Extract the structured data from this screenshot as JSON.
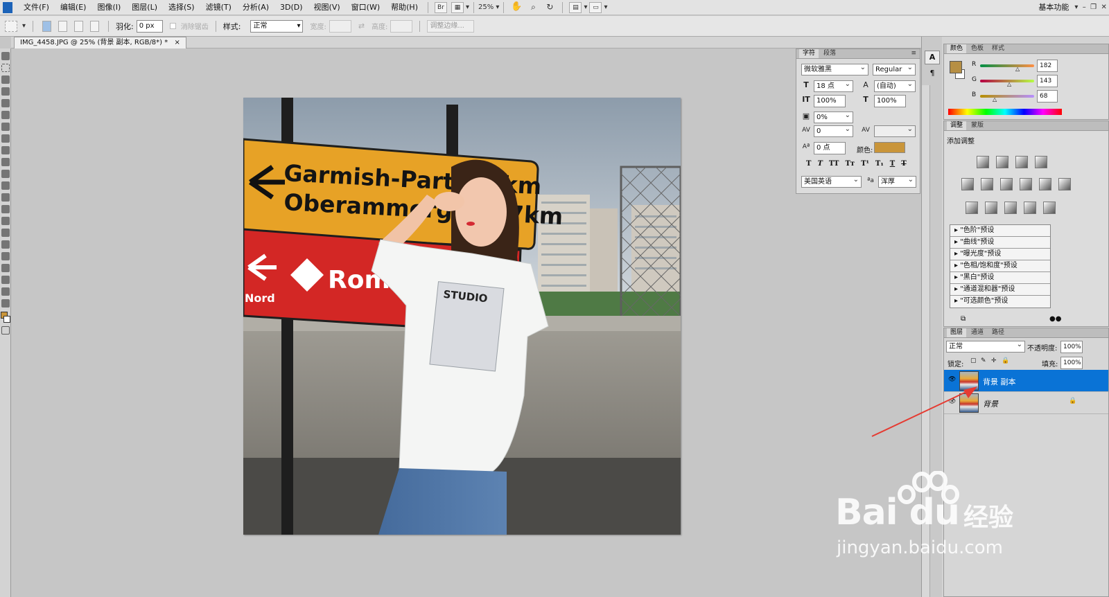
{
  "menubar": {
    "items": [
      "文件(F)",
      "编辑(E)",
      "图像(I)",
      "图层(L)",
      "选择(S)",
      "滤镜(T)",
      "分析(A)",
      "3D(D)",
      "视图(V)",
      "窗口(W)",
      "帮助(H)"
    ],
    "bridge_label": "Br",
    "zoom": "25%",
    "workspace": "基本功能"
  },
  "options": {
    "feather_label": "羽化:",
    "feather_value": "0 px",
    "antialias_label": "消除锯齿",
    "style_label": "样式:",
    "style_value": "正常",
    "width_label": "宽度:",
    "height_label": "高度:",
    "refine_edge": "调整边缘..."
  },
  "document": {
    "tab_title": "IMG_4458.JPG @ 25% (背景 副本, RGB/8*) *",
    "close": "×"
  },
  "character_panel": {
    "tab_char": "字符",
    "tab_para": "段落",
    "font_family": "微软雅黑",
    "font_style": "Regular",
    "font_size": "18 点",
    "leading": "(自动)",
    "vscale": "100%",
    "hscale": "100%",
    "tsume": "0%",
    "tracking": "0",
    "baseline": "0 点",
    "color_label": "颜色:",
    "color_value": "#c9953a",
    "language": "美国英语",
    "antialias": "浑厚"
  },
  "color_panel": {
    "tabs": [
      "颜色",
      "色板",
      "样式"
    ],
    "fg_color": "#b68f44",
    "r": "182",
    "g": "143",
    "b": "68"
  },
  "adjust_panel": {
    "tabs": [
      "调整",
      "蒙版"
    ],
    "title": "添加调整",
    "presets": [
      "\"色阶\"预设",
      "\"曲线\"预设",
      "\"曝光度\"预设",
      "\"色相/饱和度\"预设",
      "\"黑白\"预设",
      "\"通道混和器\"预设",
      "\"可选颜色\"预设"
    ]
  },
  "layers_panel": {
    "tabs": [
      "图层",
      "通道",
      "路径"
    ],
    "blend_mode": "正常",
    "opacity_label": "不透明度:",
    "opacity": "100%",
    "lock_label": "锁定:",
    "fill_label": "填充:",
    "fill": "100%",
    "layers": [
      {
        "name": "背景 副本",
        "selected": true
      },
      {
        "name": "背景",
        "selected": false
      }
    ],
    "selection_color": "#0a73d6"
  },
  "photo": {
    "sign_yellow_line1": "Garmish-Part. 46km",
    "sign_yellow_line2": "Oberammergau 27km",
    "sign_red_text": "Romantic",
    "sign_red_sub": "Nord",
    "shirt_text": "STUDIO"
  },
  "watermark": {
    "brand": "Bai  du",
    "cn": "经验",
    "url": "jingyan.baidu.com"
  }
}
